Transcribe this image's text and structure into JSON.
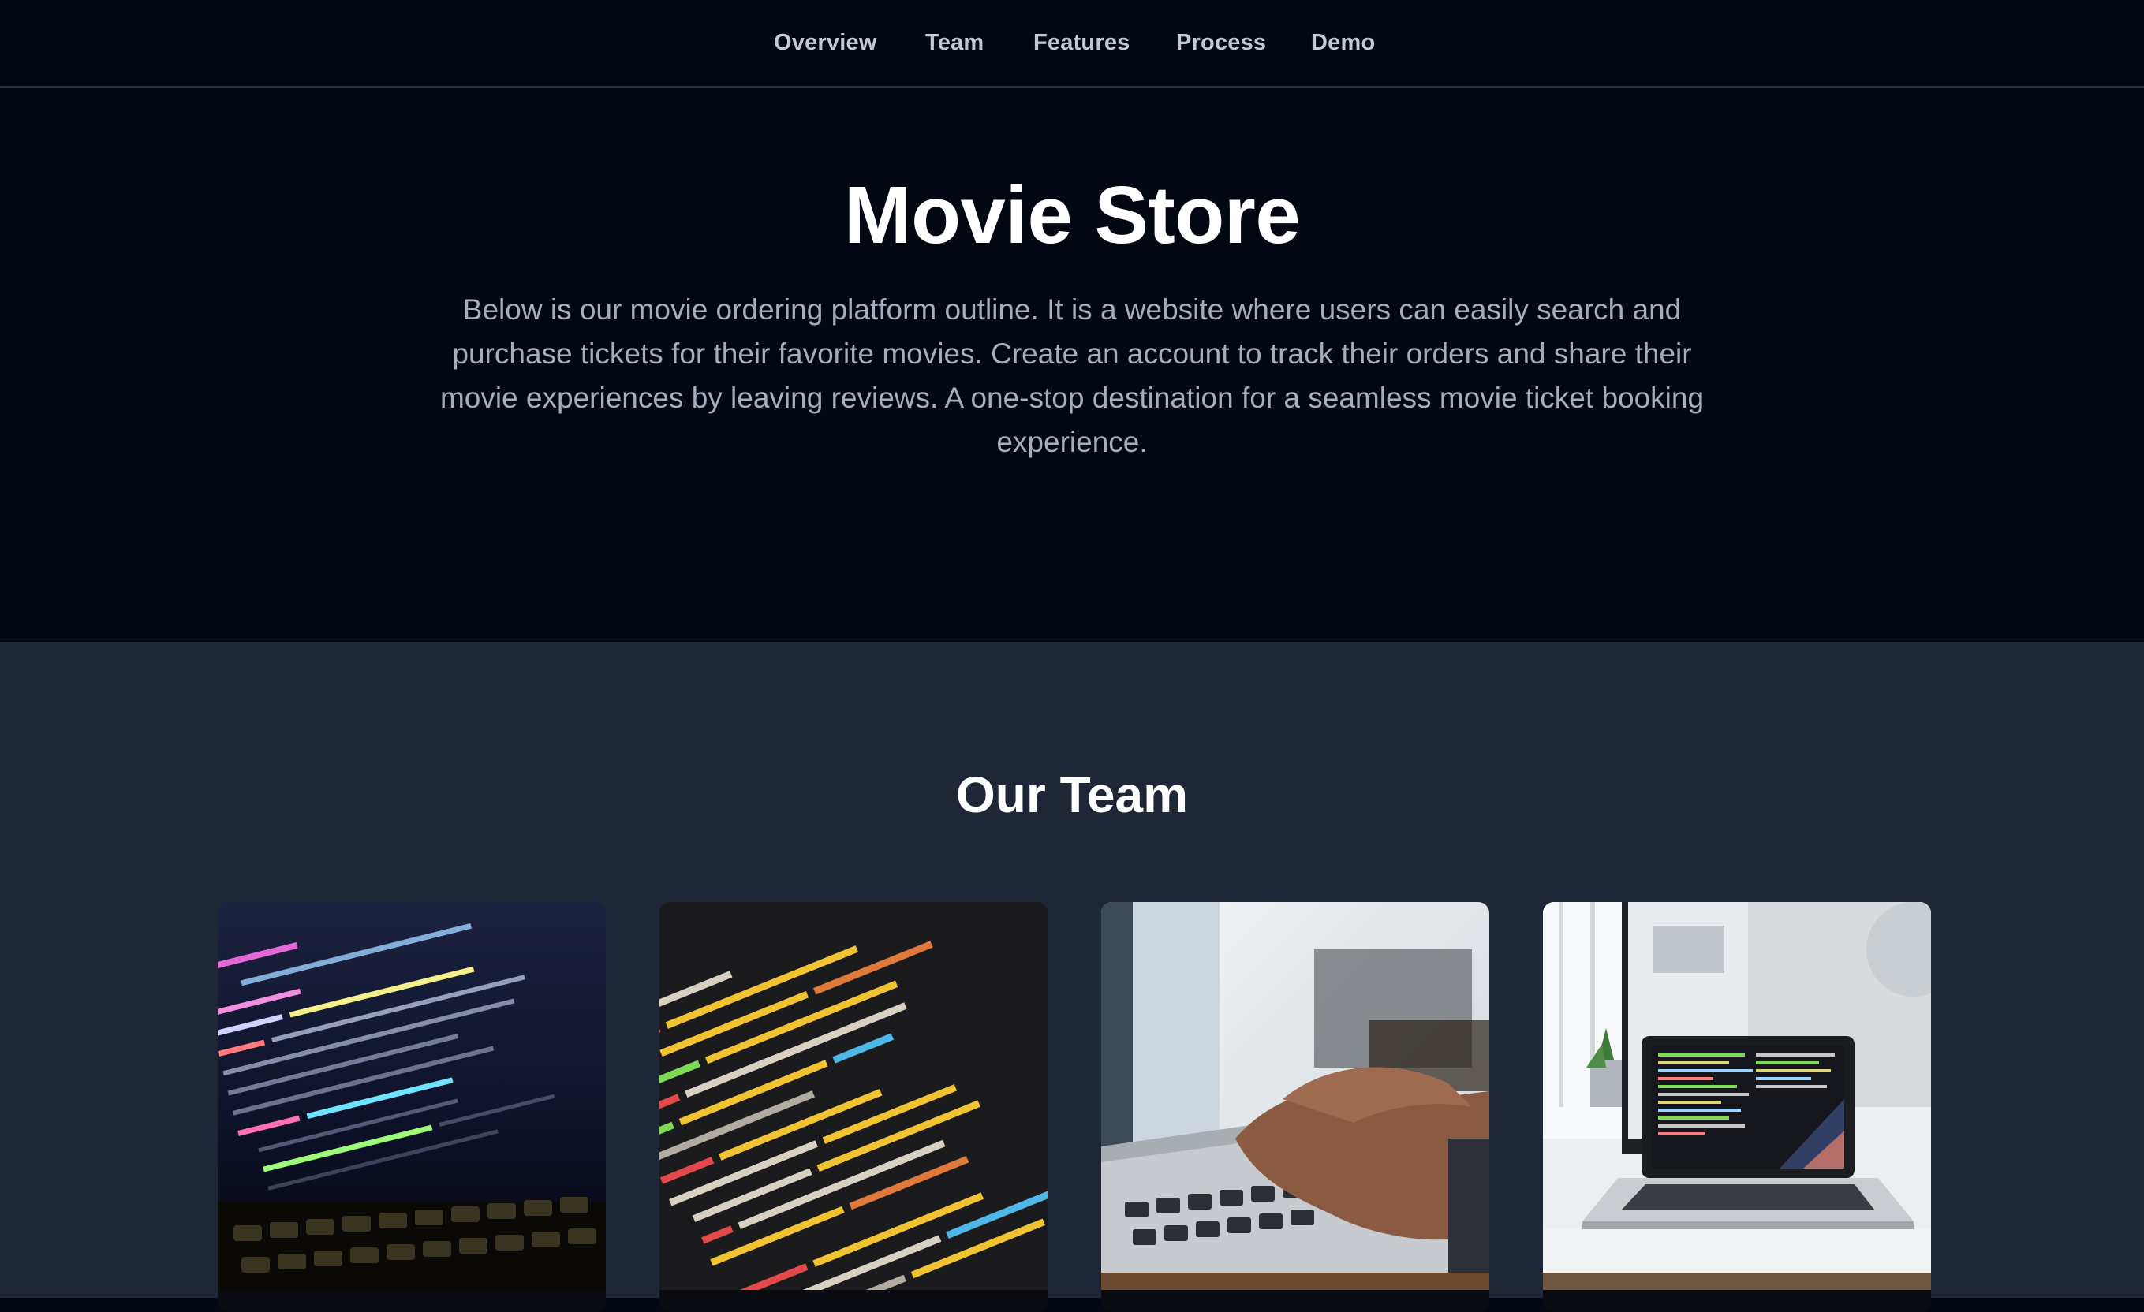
{
  "nav": {
    "items": [
      {
        "label": "Overview"
      },
      {
        "label": "Team"
      },
      {
        "label": "Features"
      },
      {
        "label": "Process"
      },
      {
        "label": "Demo"
      }
    ]
  },
  "hero": {
    "title": "Movie Store",
    "description": "Below is our movie ordering platform outline. It is a website where users can easily search and purchase tickets for their favorite movies. Create an account to track their orders and share their movie experiences by leaving reviews. A one-stop destination for a seamless movie ticket booking experience."
  },
  "team": {
    "title": "Our Team",
    "cards": [
      {
        "image": "code-on-laptop-screen-photo"
      },
      {
        "image": "colorful-code-closeup-photo"
      },
      {
        "image": "hands-typing-on-laptop-photo"
      },
      {
        "image": "laptop-with-code-on-desk-photo"
      }
    ]
  },
  "colors": {
    "page_bg": "#030712",
    "team_bg": "#1f2737",
    "nav_text": "#c4c9d2",
    "hero_text": "#a6adbb",
    "heading": "#ffffff"
  }
}
